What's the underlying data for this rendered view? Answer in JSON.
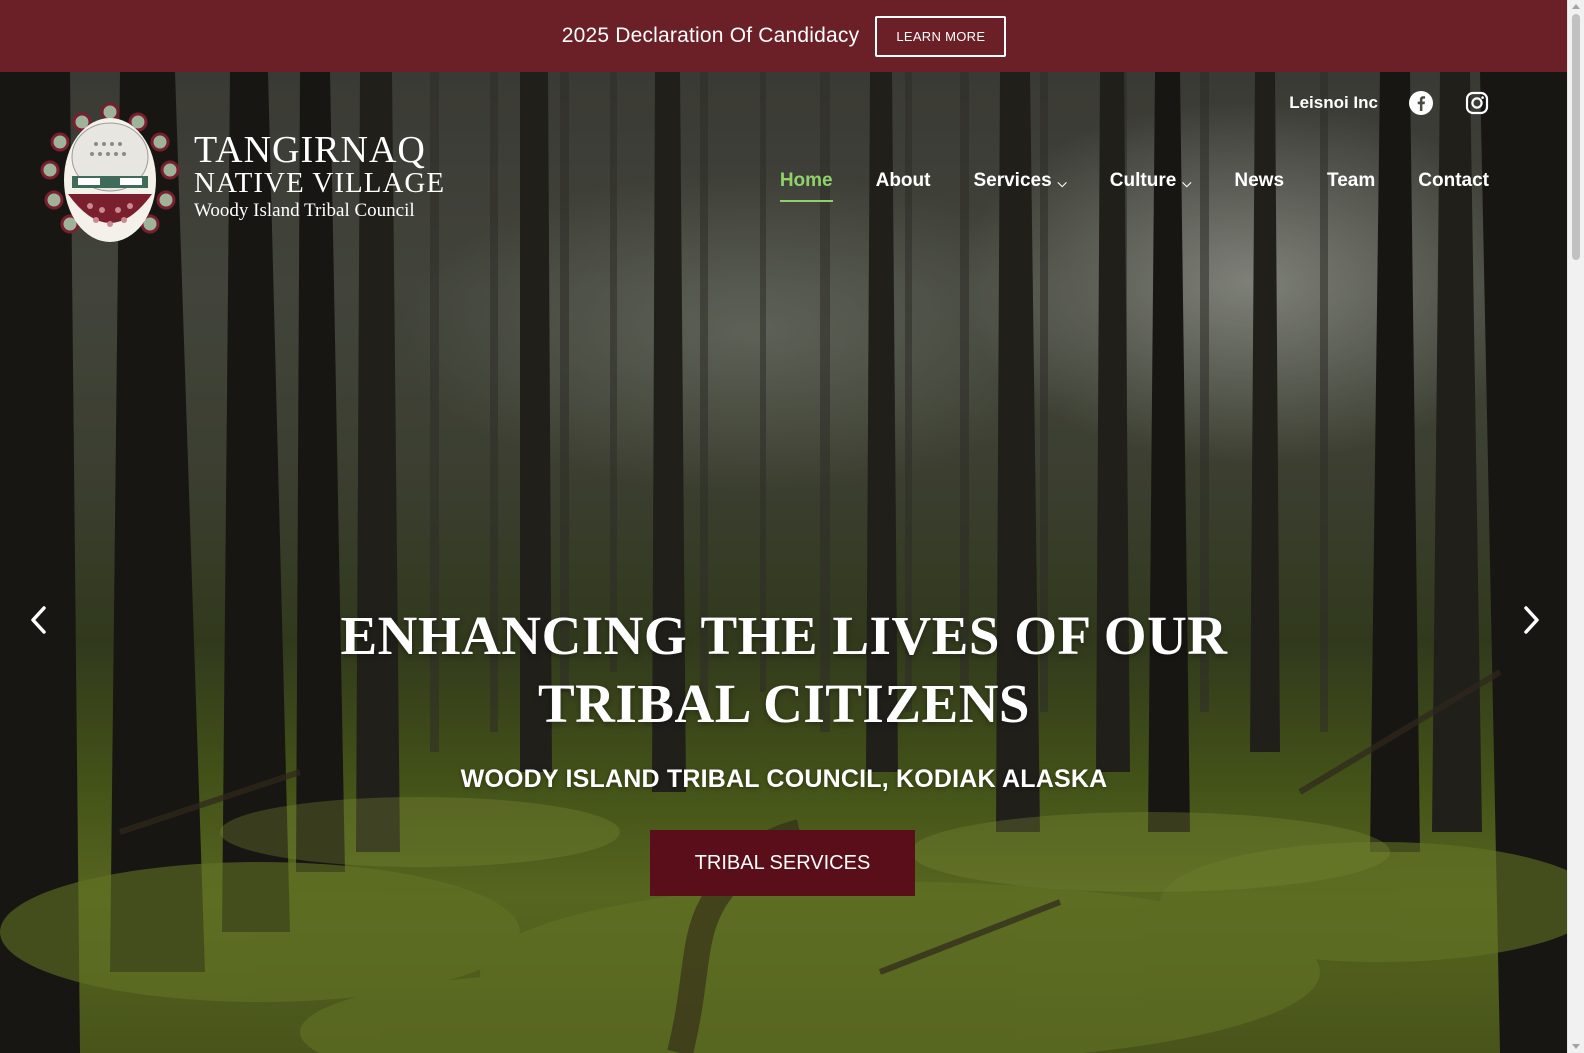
{
  "announcement": {
    "text": "2025 Declaration Of Candidacy",
    "button_label": "LEARN MORE"
  },
  "logo": {
    "line1": "TANGIRNAQ",
    "line2": "NATIVE VILLAGE",
    "line3": "Woody Island Tribal Council"
  },
  "utility": {
    "link_label": "Leisnoi Inc",
    "icons": [
      "facebook-icon",
      "instagram-icon"
    ]
  },
  "nav": {
    "items": [
      {
        "label": "Home",
        "active": true
      },
      {
        "label": "About"
      },
      {
        "label": "Services",
        "dropdown": true
      },
      {
        "label": "Culture",
        "dropdown": true
      },
      {
        "label": "News"
      },
      {
        "label": "Team"
      },
      {
        "label": "Contact"
      }
    ]
  },
  "hero": {
    "headline_line1": "ENHANCING THE LIVES OF OUR",
    "headline_line2": "TRIBAL CITIZENS",
    "subheadline": "WOODY ISLAND TRIBAL COUNCIL, KODIAK ALASKA",
    "cta_label": "TRIBAL SERVICES"
  },
  "colors": {
    "topbar": "#6b1f27",
    "cta": "#5a0e1a",
    "nav_active": "#8fd16a"
  }
}
